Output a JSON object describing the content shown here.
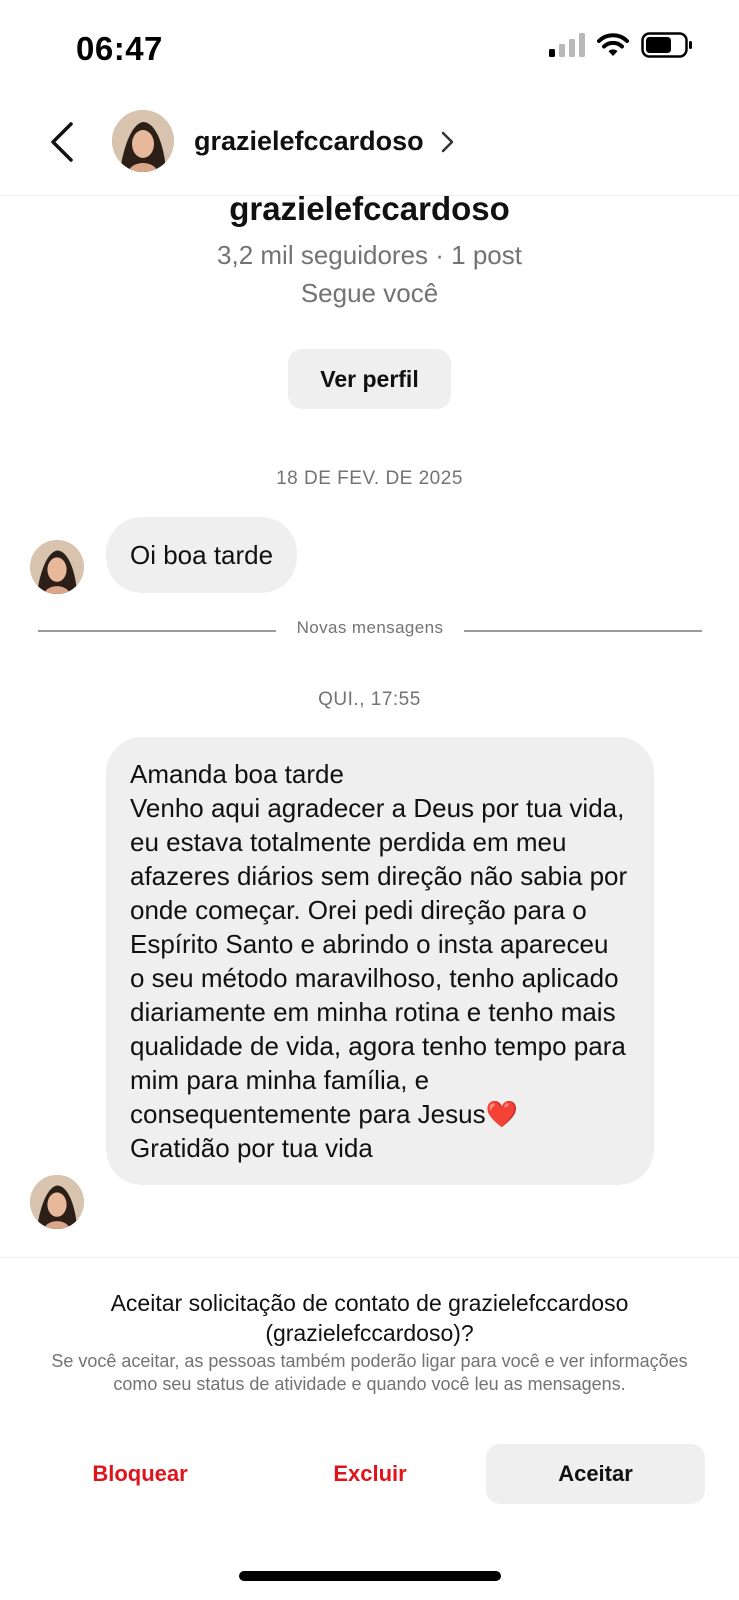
{
  "status_bar": {
    "time": "06:47"
  },
  "header": {
    "username": "grazielefccardoso"
  },
  "profile": {
    "name": "grazielefccardoso",
    "stats": "3,2 mil seguidores · 1 post",
    "follows_you": "Segue você",
    "view_profile_label": "Ver perfil"
  },
  "conversation": {
    "date_1": "18 DE FEV. DE 2025",
    "message_1": "Oi boa tarde",
    "new_messages_label": "Novas mensagens",
    "date_2": "QUI., 17:55",
    "message_2": "Amanda boa tarde\nVenho aqui agradecer a Deus por tua vida, eu estava totalmente perdida em meu afazeres diários sem direção não sabia por onde começar. Orei pedi direção para o Espírito Santo e abrindo o insta apareceu o seu método maravilhoso, tenho aplicado diariamente em minha rotina e tenho mais qualidade de vida, agora tenho tempo para mim para minha família, e consequentemente para Jesus❤️\nGratidão por tua vida"
  },
  "request": {
    "title": "Aceitar solicitação de contato de grazielefccardoso (grazielefccardoso)?",
    "description": "Se você aceitar, as pessoas também poderão ligar para você e ver informações como seu status de atividade e quando você leu as mensagens.",
    "block_label": "Bloquear",
    "delete_label": "Excluir",
    "accept_label": "Aceitar"
  },
  "colors": {
    "danger": "#e0151c",
    "bubble": "#efefef",
    "muted": "#737373"
  }
}
